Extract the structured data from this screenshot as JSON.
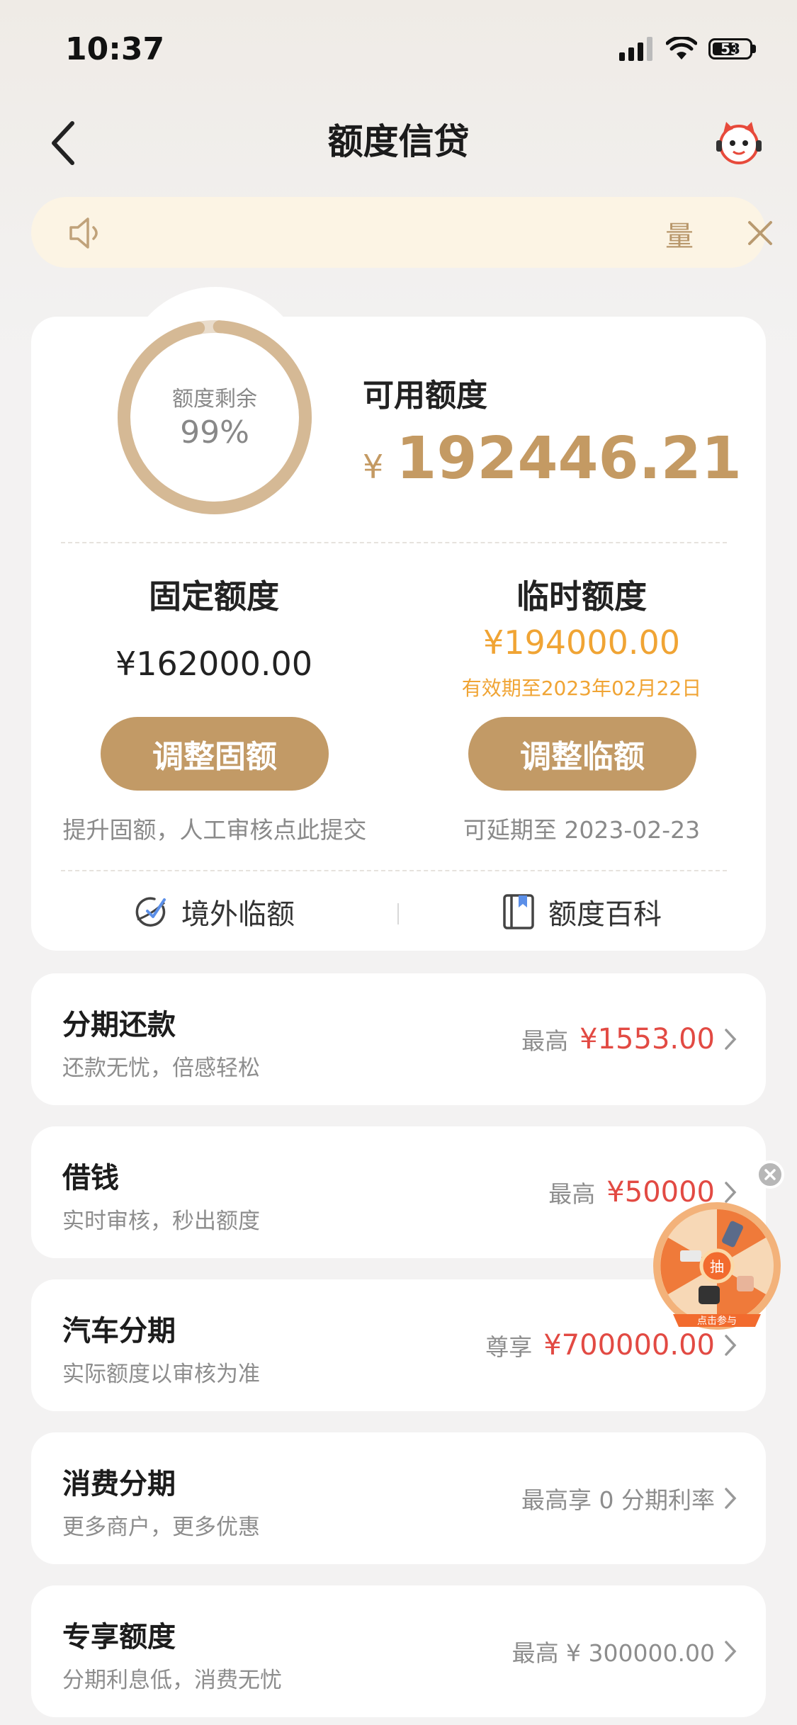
{
  "status_bar": {
    "time": "10:37",
    "battery": "53"
  },
  "nav": {
    "title": "额度信贷"
  },
  "notice": {
    "text": "量"
  },
  "quota": {
    "ring_label": "额度剩余",
    "ring_percent": "99%",
    "ring_fraction": 0.99,
    "available_label": "可用额度",
    "currency": "¥",
    "available_amount": "192446.21",
    "fixed": {
      "title": "固定额度",
      "amount": "¥162000.00",
      "button": "调整固额",
      "note": "提升固额，人工审核点此提交"
    },
    "temporary": {
      "title": "临时额度",
      "amount": "¥194000.00",
      "valid_until": "有效期至2023年02月22日",
      "button": "调整临额",
      "note": "可延期至 2023-02-23"
    },
    "tools": [
      {
        "label": "境外临额",
        "icon": "globe-plane-icon"
      },
      {
        "label": "额度百科",
        "icon": "book-icon"
      }
    ]
  },
  "items": [
    {
      "title": "分期还款",
      "subtitle": "还款无忧，倍感轻松",
      "prefix": "最高",
      "amount": "¥1553.00"
    },
    {
      "title": "借钱",
      "subtitle": "实时审核，秒出额度",
      "prefix": "最高",
      "amount": "¥50000"
    },
    {
      "title": "汽车分期",
      "subtitle": "实际额度以审核为准",
      "prefix": "尊享",
      "amount": "¥700000.00"
    },
    {
      "title": "消费分期",
      "subtitle": "更多商户，更多优惠",
      "text": "最高享 0 分期利率"
    },
    {
      "title": "专享额度",
      "subtitle": "分期利息低，消费无忧",
      "text": "最高 ¥ 300000.00"
    }
  ],
  "lucky_wheel": {
    "center": "抽",
    "cta": "点击参与"
  },
  "colors": {
    "accent": "#c29a66",
    "orange": "#f0a434",
    "red": "#e24a43"
  }
}
